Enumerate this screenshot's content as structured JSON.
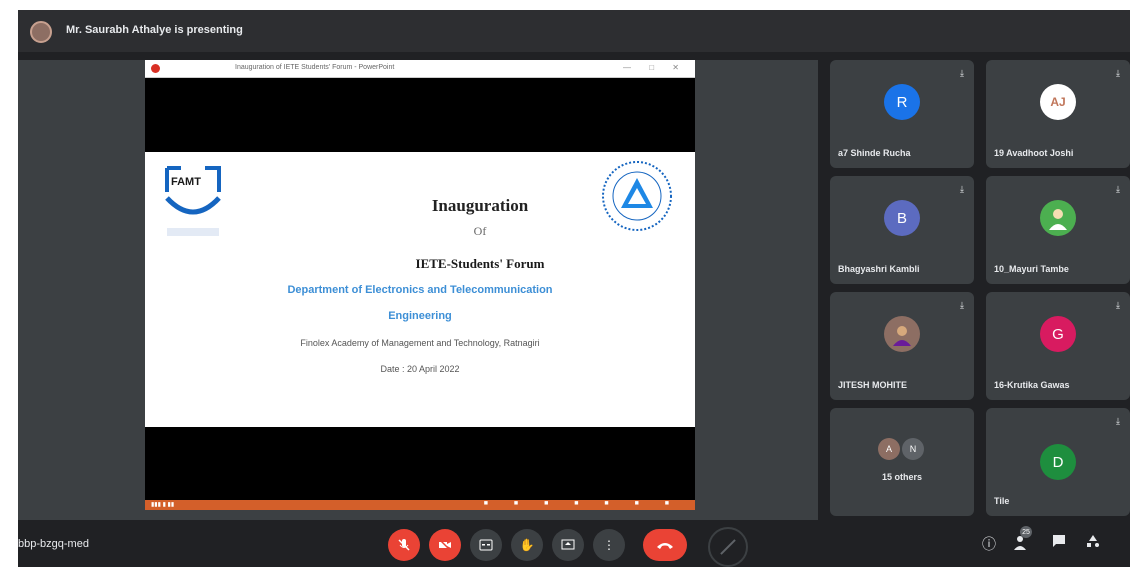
{
  "header": {
    "presenting_text": "Mr. Saurabh Athalye is presenting"
  },
  "slide": {
    "window_title": "Inauguration of IETE Students' Forum - PowerPoint",
    "title": "Inauguration",
    "of": "Of",
    "forum": "IETE-Students' Forum",
    "dept_line1": "Department of Electronics and Telecommunication",
    "dept_line2": "Engineering",
    "college": "Finolex Academy of Management and Technology, Ratnagiri",
    "date": "Date : 20 April 2022",
    "logo_left_text": "FAMT"
  },
  "participants": [
    {
      "initial": "R",
      "name": "a7 Shinde Rucha",
      "color": "#1a73e8"
    },
    {
      "initial": "AJ",
      "name": "19 Avadhoot Joshi",
      "color": "#ffffff"
    },
    {
      "initial": "B",
      "name": "Bhagyashri Kambli",
      "color": "#5c6bc0"
    },
    {
      "initial": "",
      "name": "10_Mayuri Tambe",
      "color": "#4caf50"
    },
    {
      "initial": "",
      "name": "JITESH MOHITE",
      "color": "#8d6e63"
    },
    {
      "initial": "G",
      "name": "16-Krutika Gawas",
      "color": "#d81b60"
    },
    {
      "initial": "",
      "name": "15 others",
      "color": ""
    },
    {
      "initial": "D",
      "name": "Tile",
      "color": "#1e8e3e"
    }
  ],
  "others": {
    "a1": "A",
    "a2": "N"
  },
  "bottom": {
    "meeting_code": "bbp-bzgq-med",
    "participant_count": "25"
  },
  "colors": {
    "accent_red": "#ea4335",
    "bar_dark": "#202124",
    "tile_grey": "#3c4043"
  }
}
